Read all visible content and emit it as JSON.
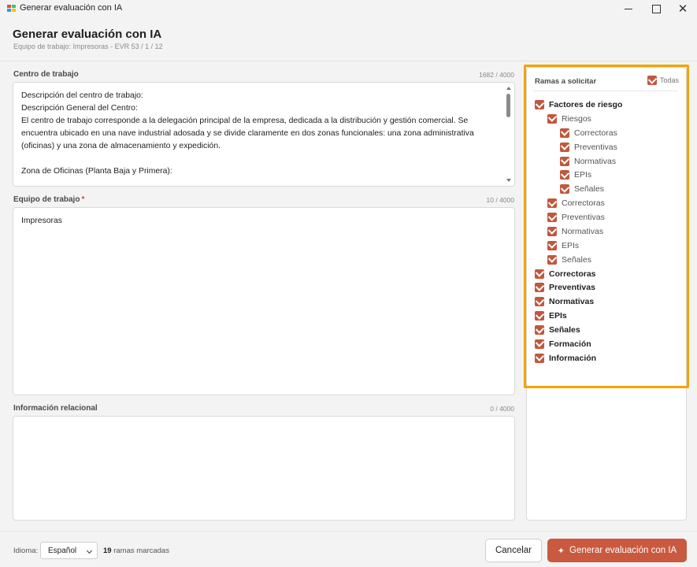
{
  "window": {
    "title": "Generar evaluación con IA",
    "close_glyph": "✕"
  },
  "header": {
    "title": "Generar evaluación con IA",
    "subtitle": "Equipo de trabajo: Impresoras - EVR 53 / 1 / 12"
  },
  "fields": {
    "centro": {
      "label": "Centro de trabajo",
      "count": "1682 / 4000",
      "value": "Descripción del centro de trabajo:\nDescripción General del Centro:\nEl centro de trabajo corresponde a la delegación principal de la empresa, dedicada a la distribución y gestión comercial. Se encuentra ubicado en una nave industrial adosada y se divide claramente en dos zonas funcionales: una zona administrativa (oficinas) y una zona de almacenamiento y expedición.\n\nZona de Oficinas (Planta Baja y Primera):"
    },
    "equipo": {
      "label": "Equipo de trabajo",
      "required_mark": "*",
      "count": "10 / 4000",
      "value": "Impresoras"
    },
    "relacional": {
      "label": "Información relacional",
      "count": "0 / 4000",
      "value": ""
    }
  },
  "branches": {
    "heading": "Ramas a solicitar",
    "all_label": "Todas",
    "items": [
      {
        "label": "Factores de riesgo",
        "level": 0
      },
      {
        "label": "Riesgos",
        "level": 1
      },
      {
        "label": "Correctoras",
        "level": 2
      },
      {
        "label": "Preventivas",
        "level": 2
      },
      {
        "label": "Normativas",
        "level": 2
      },
      {
        "label": "EPIs",
        "level": 2
      },
      {
        "label": "Señales",
        "level": 2
      },
      {
        "label": "Correctoras",
        "level": 1
      },
      {
        "label": "Preventivas",
        "level": 1
      },
      {
        "label": "Normativas",
        "level": 1
      },
      {
        "label": "EPIs",
        "level": 1
      },
      {
        "label": "Señales",
        "level": 1
      },
      {
        "label": "Correctoras",
        "level": 0
      },
      {
        "label": "Preventivas",
        "level": 0
      },
      {
        "label": "Normativas",
        "level": 0
      },
      {
        "label": "EPIs",
        "level": 0
      },
      {
        "label": "Señales",
        "level": 0
      },
      {
        "label": "Formación",
        "level": 0
      },
      {
        "label": "Información",
        "level": 0
      }
    ]
  },
  "footer": {
    "language_label": "Idioma:",
    "language_value": "Español",
    "marked_count": "19",
    "marked_label": "ramas marcadas",
    "cancel_label": "Cancelar",
    "generate_label": "Generar evaluación con IA"
  },
  "colors": {
    "accent": "#c9593f",
    "highlight": "#f4a300"
  }
}
